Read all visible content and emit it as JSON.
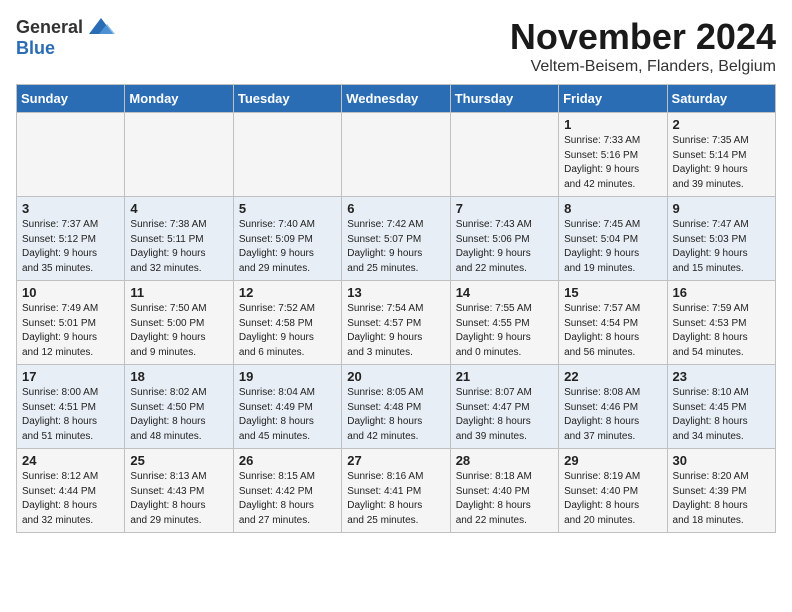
{
  "logo": {
    "general": "General",
    "blue": "Blue"
  },
  "title": "November 2024",
  "location": "Veltem-Beisem, Flanders, Belgium",
  "weekdays": [
    "Sunday",
    "Monday",
    "Tuesday",
    "Wednesday",
    "Thursday",
    "Friday",
    "Saturday"
  ],
  "weeks": [
    [
      {
        "day": "",
        "info": ""
      },
      {
        "day": "",
        "info": ""
      },
      {
        "day": "",
        "info": ""
      },
      {
        "day": "",
        "info": ""
      },
      {
        "day": "",
        "info": ""
      },
      {
        "day": "1",
        "info": "Sunrise: 7:33 AM\nSunset: 5:16 PM\nDaylight: 9 hours\nand 42 minutes."
      },
      {
        "day": "2",
        "info": "Sunrise: 7:35 AM\nSunset: 5:14 PM\nDaylight: 9 hours\nand 39 minutes."
      }
    ],
    [
      {
        "day": "3",
        "info": "Sunrise: 7:37 AM\nSunset: 5:12 PM\nDaylight: 9 hours\nand 35 minutes."
      },
      {
        "day": "4",
        "info": "Sunrise: 7:38 AM\nSunset: 5:11 PM\nDaylight: 9 hours\nand 32 minutes."
      },
      {
        "day": "5",
        "info": "Sunrise: 7:40 AM\nSunset: 5:09 PM\nDaylight: 9 hours\nand 29 minutes."
      },
      {
        "day": "6",
        "info": "Sunrise: 7:42 AM\nSunset: 5:07 PM\nDaylight: 9 hours\nand 25 minutes."
      },
      {
        "day": "7",
        "info": "Sunrise: 7:43 AM\nSunset: 5:06 PM\nDaylight: 9 hours\nand 22 minutes."
      },
      {
        "day": "8",
        "info": "Sunrise: 7:45 AM\nSunset: 5:04 PM\nDaylight: 9 hours\nand 19 minutes."
      },
      {
        "day": "9",
        "info": "Sunrise: 7:47 AM\nSunset: 5:03 PM\nDaylight: 9 hours\nand 15 minutes."
      }
    ],
    [
      {
        "day": "10",
        "info": "Sunrise: 7:49 AM\nSunset: 5:01 PM\nDaylight: 9 hours\nand 12 minutes."
      },
      {
        "day": "11",
        "info": "Sunrise: 7:50 AM\nSunset: 5:00 PM\nDaylight: 9 hours\nand 9 minutes."
      },
      {
        "day": "12",
        "info": "Sunrise: 7:52 AM\nSunset: 4:58 PM\nDaylight: 9 hours\nand 6 minutes."
      },
      {
        "day": "13",
        "info": "Sunrise: 7:54 AM\nSunset: 4:57 PM\nDaylight: 9 hours\nand 3 minutes."
      },
      {
        "day": "14",
        "info": "Sunrise: 7:55 AM\nSunset: 4:55 PM\nDaylight: 9 hours\nand 0 minutes."
      },
      {
        "day": "15",
        "info": "Sunrise: 7:57 AM\nSunset: 4:54 PM\nDaylight: 8 hours\nand 56 minutes."
      },
      {
        "day": "16",
        "info": "Sunrise: 7:59 AM\nSunset: 4:53 PM\nDaylight: 8 hours\nand 54 minutes."
      }
    ],
    [
      {
        "day": "17",
        "info": "Sunrise: 8:00 AM\nSunset: 4:51 PM\nDaylight: 8 hours\nand 51 minutes."
      },
      {
        "day": "18",
        "info": "Sunrise: 8:02 AM\nSunset: 4:50 PM\nDaylight: 8 hours\nand 48 minutes."
      },
      {
        "day": "19",
        "info": "Sunrise: 8:04 AM\nSunset: 4:49 PM\nDaylight: 8 hours\nand 45 minutes."
      },
      {
        "day": "20",
        "info": "Sunrise: 8:05 AM\nSunset: 4:48 PM\nDaylight: 8 hours\nand 42 minutes."
      },
      {
        "day": "21",
        "info": "Sunrise: 8:07 AM\nSunset: 4:47 PM\nDaylight: 8 hours\nand 39 minutes."
      },
      {
        "day": "22",
        "info": "Sunrise: 8:08 AM\nSunset: 4:46 PM\nDaylight: 8 hours\nand 37 minutes."
      },
      {
        "day": "23",
        "info": "Sunrise: 8:10 AM\nSunset: 4:45 PM\nDaylight: 8 hours\nand 34 minutes."
      }
    ],
    [
      {
        "day": "24",
        "info": "Sunrise: 8:12 AM\nSunset: 4:44 PM\nDaylight: 8 hours\nand 32 minutes."
      },
      {
        "day": "25",
        "info": "Sunrise: 8:13 AM\nSunset: 4:43 PM\nDaylight: 8 hours\nand 29 minutes."
      },
      {
        "day": "26",
        "info": "Sunrise: 8:15 AM\nSunset: 4:42 PM\nDaylight: 8 hours\nand 27 minutes."
      },
      {
        "day": "27",
        "info": "Sunrise: 8:16 AM\nSunset: 4:41 PM\nDaylight: 8 hours\nand 25 minutes."
      },
      {
        "day": "28",
        "info": "Sunrise: 8:18 AM\nSunset: 4:40 PM\nDaylight: 8 hours\nand 22 minutes."
      },
      {
        "day": "29",
        "info": "Sunrise: 8:19 AM\nSunset: 4:40 PM\nDaylight: 8 hours\nand 20 minutes."
      },
      {
        "day": "30",
        "info": "Sunrise: 8:20 AM\nSunset: 4:39 PM\nDaylight: 8 hours\nand 18 minutes."
      }
    ]
  ]
}
